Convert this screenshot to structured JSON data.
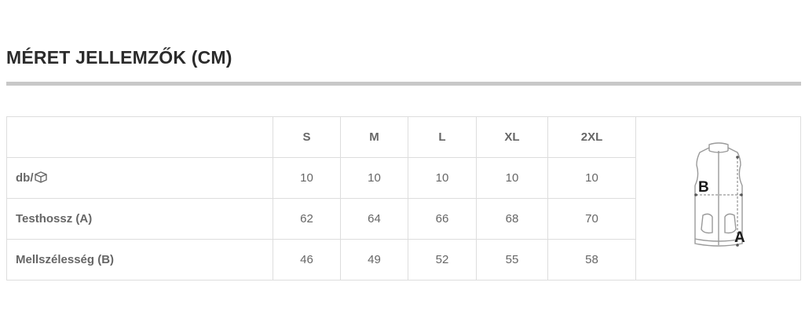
{
  "title": "MÉRET JELLEMZŐK (CM)",
  "table": {
    "headers": [
      "",
      "S",
      "M",
      "L",
      "XL",
      "2XL"
    ],
    "rows": [
      {
        "label": "db/",
        "label_icon": "box-icon",
        "values": [
          "10",
          "10",
          "10",
          "10",
          "10"
        ]
      },
      {
        "label": "Testhossz (A)",
        "values": [
          "62",
          "64",
          "66",
          "68",
          "70"
        ]
      },
      {
        "label": "Mellszélesség (B)",
        "values": [
          "46",
          "49",
          "52",
          "55",
          "58"
        ]
      }
    ]
  },
  "diagram": {
    "icon": "vest-measurement-diagram",
    "label_b": "B",
    "label_a": "A"
  },
  "colors": {
    "title": "#2b2b2b",
    "rule": "#c8c8c8",
    "border": "#dddddd",
    "text": "#666666"
  }
}
